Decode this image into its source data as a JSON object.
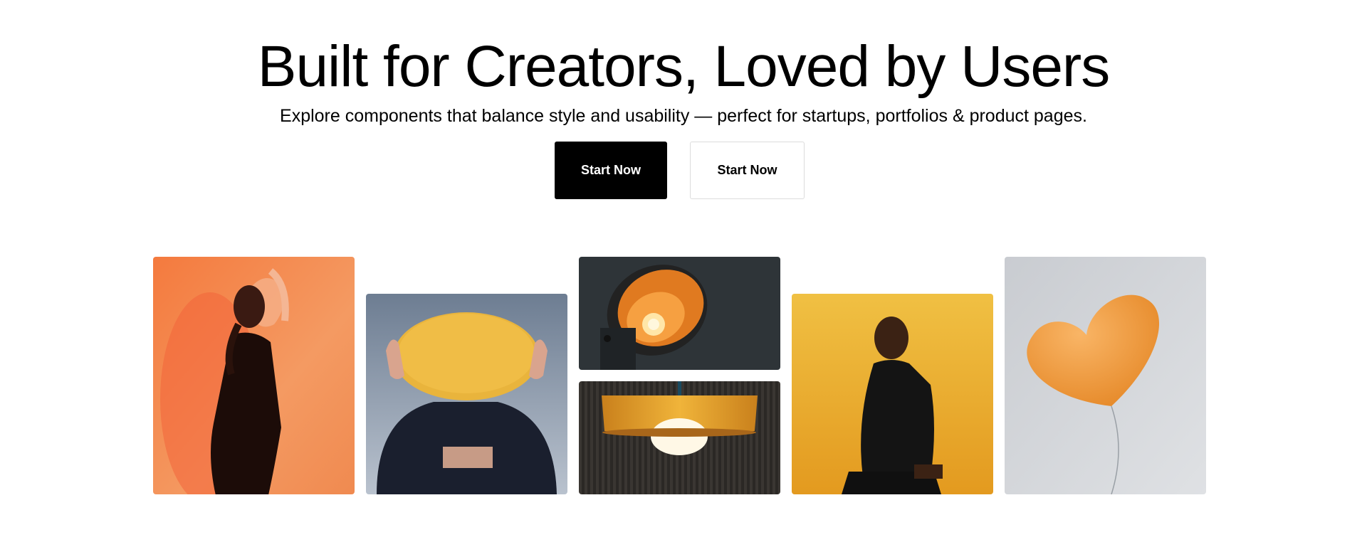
{
  "hero": {
    "title": "Built for Creators, Loved by Users",
    "subtitle": "Explore components that balance style and usability — perfect for startups, portfolios & product pages.",
    "primary_button_label": "Start Now",
    "secondary_button_label": "Start Now"
  },
  "gallery": {
    "images": [
      {
        "subject": "woman-orange-backdrop"
      },
      {
        "subject": "person-holding-yellow-disc"
      },
      {
        "subject": "orange-spotlight-lamp"
      },
      {
        "subject": "yellow-pendant-lamp"
      },
      {
        "subject": "man-seated-yellow-backdrop"
      },
      {
        "subject": "orange-heart-balloon"
      }
    ]
  },
  "colors": {
    "primary_button_bg": "#000000",
    "secondary_button_border": "#dcdcdc",
    "accent_orange": "#f08a3c",
    "accent_yellow": "#f0b43a"
  }
}
